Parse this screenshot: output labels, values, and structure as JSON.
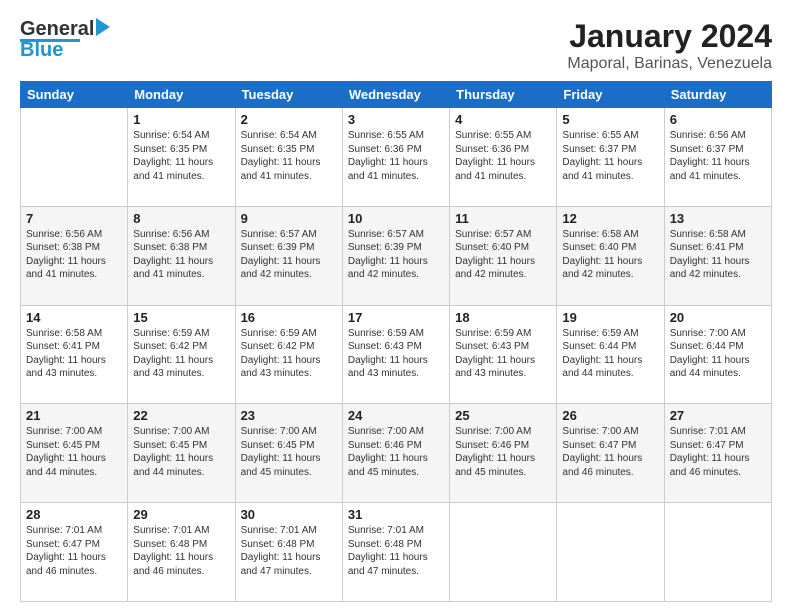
{
  "header": {
    "logo_line1": "General",
    "logo_line2": "Blue",
    "title": "January 2024",
    "subtitle": "Maporal, Barinas, Venezuela"
  },
  "days_of_week": [
    "Sunday",
    "Monday",
    "Tuesday",
    "Wednesday",
    "Thursday",
    "Friday",
    "Saturday"
  ],
  "weeks": [
    [
      {
        "num": "",
        "detail": ""
      },
      {
        "num": "1",
        "detail": "Sunrise: 6:54 AM\nSunset: 6:35 PM\nDaylight: 11 hours\nand 41 minutes."
      },
      {
        "num": "2",
        "detail": "Sunrise: 6:54 AM\nSunset: 6:35 PM\nDaylight: 11 hours\nand 41 minutes."
      },
      {
        "num": "3",
        "detail": "Sunrise: 6:55 AM\nSunset: 6:36 PM\nDaylight: 11 hours\nand 41 minutes."
      },
      {
        "num": "4",
        "detail": "Sunrise: 6:55 AM\nSunset: 6:36 PM\nDaylight: 11 hours\nand 41 minutes."
      },
      {
        "num": "5",
        "detail": "Sunrise: 6:55 AM\nSunset: 6:37 PM\nDaylight: 11 hours\nand 41 minutes."
      },
      {
        "num": "6",
        "detail": "Sunrise: 6:56 AM\nSunset: 6:37 PM\nDaylight: 11 hours\nand 41 minutes."
      }
    ],
    [
      {
        "num": "7",
        "detail": "Sunrise: 6:56 AM\nSunset: 6:38 PM\nDaylight: 11 hours\nand 41 minutes."
      },
      {
        "num": "8",
        "detail": "Sunrise: 6:56 AM\nSunset: 6:38 PM\nDaylight: 11 hours\nand 41 minutes."
      },
      {
        "num": "9",
        "detail": "Sunrise: 6:57 AM\nSunset: 6:39 PM\nDaylight: 11 hours\nand 42 minutes."
      },
      {
        "num": "10",
        "detail": "Sunrise: 6:57 AM\nSunset: 6:39 PM\nDaylight: 11 hours\nand 42 minutes."
      },
      {
        "num": "11",
        "detail": "Sunrise: 6:57 AM\nSunset: 6:40 PM\nDaylight: 11 hours\nand 42 minutes."
      },
      {
        "num": "12",
        "detail": "Sunrise: 6:58 AM\nSunset: 6:40 PM\nDaylight: 11 hours\nand 42 minutes."
      },
      {
        "num": "13",
        "detail": "Sunrise: 6:58 AM\nSunset: 6:41 PM\nDaylight: 11 hours\nand 42 minutes."
      }
    ],
    [
      {
        "num": "14",
        "detail": "Sunrise: 6:58 AM\nSunset: 6:41 PM\nDaylight: 11 hours\nand 43 minutes."
      },
      {
        "num": "15",
        "detail": "Sunrise: 6:59 AM\nSunset: 6:42 PM\nDaylight: 11 hours\nand 43 minutes."
      },
      {
        "num": "16",
        "detail": "Sunrise: 6:59 AM\nSunset: 6:42 PM\nDaylight: 11 hours\nand 43 minutes."
      },
      {
        "num": "17",
        "detail": "Sunrise: 6:59 AM\nSunset: 6:43 PM\nDaylight: 11 hours\nand 43 minutes."
      },
      {
        "num": "18",
        "detail": "Sunrise: 6:59 AM\nSunset: 6:43 PM\nDaylight: 11 hours\nand 43 minutes."
      },
      {
        "num": "19",
        "detail": "Sunrise: 6:59 AM\nSunset: 6:44 PM\nDaylight: 11 hours\nand 44 minutes."
      },
      {
        "num": "20",
        "detail": "Sunrise: 7:00 AM\nSunset: 6:44 PM\nDaylight: 11 hours\nand 44 minutes."
      }
    ],
    [
      {
        "num": "21",
        "detail": "Sunrise: 7:00 AM\nSunset: 6:45 PM\nDaylight: 11 hours\nand 44 minutes."
      },
      {
        "num": "22",
        "detail": "Sunrise: 7:00 AM\nSunset: 6:45 PM\nDaylight: 11 hours\nand 44 minutes."
      },
      {
        "num": "23",
        "detail": "Sunrise: 7:00 AM\nSunset: 6:45 PM\nDaylight: 11 hours\nand 45 minutes."
      },
      {
        "num": "24",
        "detail": "Sunrise: 7:00 AM\nSunset: 6:46 PM\nDaylight: 11 hours\nand 45 minutes."
      },
      {
        "num": "25",
        "detail": "Sunrise: 7:00 AM\nSunset: 6:46 PM\nDaylight: 11 hours\nand 45 minutes."
      },
      {
        "num": "26",
        "detail": "Sunrise: 7:00 AM\nSunset: 6:47 PM\nDaylight: 11 hours\nand 46 minutes."
      },
      {
        "num": "27",
        "detail": "Sunrise: 7:01 AM\nSunset: 6:47 PM\nDaylight: 11 hours\nand 46 minutes."
      }
    ],
    [
      {
        "num": "28",
        "detail": "Sunrise: 7:01 AM\nSunset: 6:47 PM\nDaylight: 11 hours\nand 46 minutes."
      },
      {
        "num": "29",
        "detail": "Sunrise: 7:01 AM\nSunset: 6:48 PM\nDaylight: 11 hours\nand 46 minutes."
      },
      {
        "num": "30",
        "detail": "Sunrise: 7:01 AM\nSunset: 6:48 PM\nDaylight: 11 hours\nand 47 minutes."
      },
      {
        "num": "31",
        "detail": "Sunrise: 7:01 AM\nSunset: 6:48 PM\nDaylight: 11 hours\nand 47 minutes."
      },
      {
        "num": "",
        "detail": ""
      },
      {
        "num": "",
        "detail": ""
      },
      {
        "num": "",
        "detail": ""
      }
    ]
  ]
}
